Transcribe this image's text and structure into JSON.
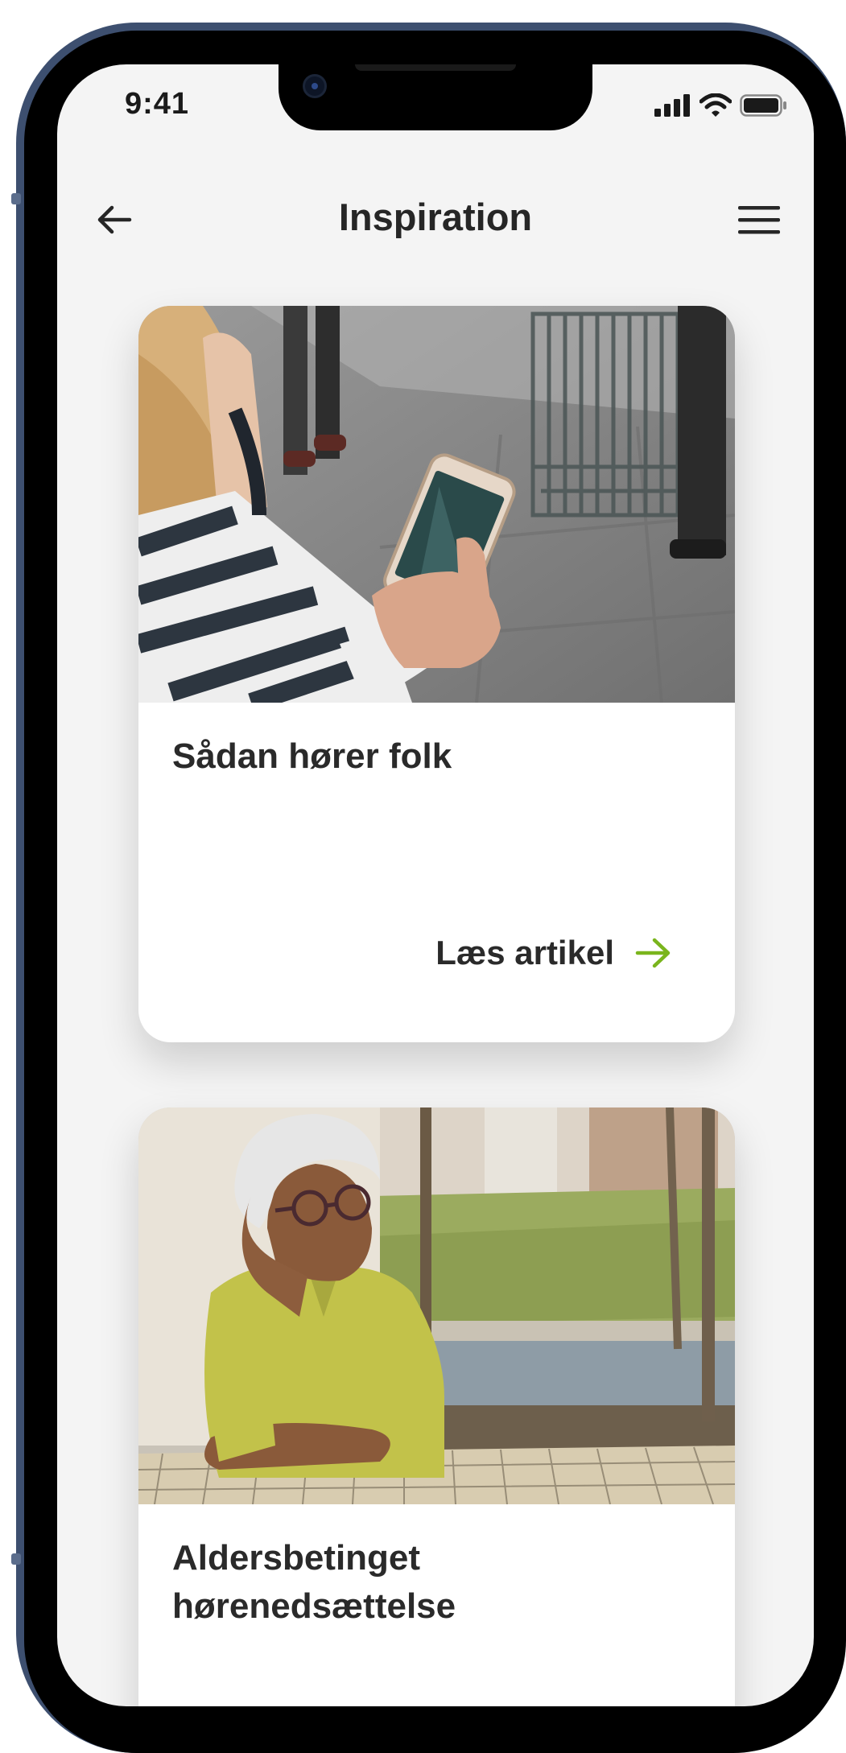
{
  "status_bar": {
    "time": "9:41"
  },
  "header": {
    "title": "Inspiration"
  },
  "articles": [
    {
      "title": "Sådan hører folk",
      "link_label": "Læs artikel"
    },
    {
      "title": "Aldersbetinget hørenedsættelse"
    }
  ],
  "colors": {
    "accent": "#7ab51d",
    "background": "#f4f4f4",
    "frame": "#3d4f6f"
  },
  "icons": [
    "back-arrow-icon",
    "hamburger-menu-icon",
    "cellular-signal-icon",
    "wifi-icon",
    "battery-icon",
    "arrow-right-icon"
  ]
}
